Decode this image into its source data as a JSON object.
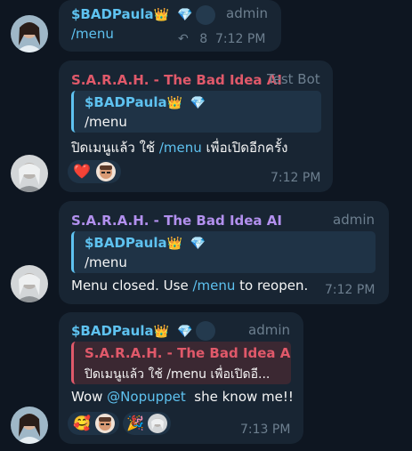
{
  "messages": [
    {
      "sender": "$BADPaula",
      "sender_badges": [
        "👑",
        "💎"
      ],
      "role": "admin",
      "text": "/menu",
      "reply_count": "8",
      "time": "7:12 PM"
    },
    {
      "sender": "S.A.R.A.H. - The Bad Idea AI",
      "role": "Test Bot",
      "quote_sender": "$BADPaula",
      "quote_badges": [
        "👑",
        "💎"
      ],
      "quote_text": "/menu",
      "text_before": "ปิดเมนูแล้ว ใช้ ",
      "text_link": "/menu",
      "text_after": " เพื่อเปิดอีกครั้ง",
      "reactions": [
        "❤️"
      ],
      "time": "7:12 PM"
    },
    {
      "sender": "S.A.R.A.H. - The Bad Idea AI",
      "role": "admin",
      "quote_sender": "$BADPaula",
      "quote_badges": [
        "👑",
        "💎"
      ],
      "quote_text": "/menu",
      "text_before": "Menu closed. Use ",
      "text_link": "/menu",
      "text_after": " to reopen.",
      "time": "7:12 PM"
    },
    {
      "sender": "$BADPaula",
      "sender_badges": [
        "👑",
        "💎"
      ],
      "role": "admin",
      "quote_sender": "S.A.R.A.H. - The Bad Idea AI",
      "quote_text": "ปิดเมนูแล้ว ใช้ /menu เพื่อเปิดอี...",
      "text_before": "Wow ",
      "text_mention": "@Nopuppet",
      "text_after": "  she know me!!",
      "reactions": [
        "🥰",
        "🎉"
      ],
      "time": "7:13 PM"
    }
  ],
  "colors": {
    "background": "#0e1621",
    "bubble": "#182533",
    "link": "#5ec2f0",
    "bot_name": "#e0596a",
    "admin_name": "#b290ee",
    "meta": "#6d7f8f"
  }
}
